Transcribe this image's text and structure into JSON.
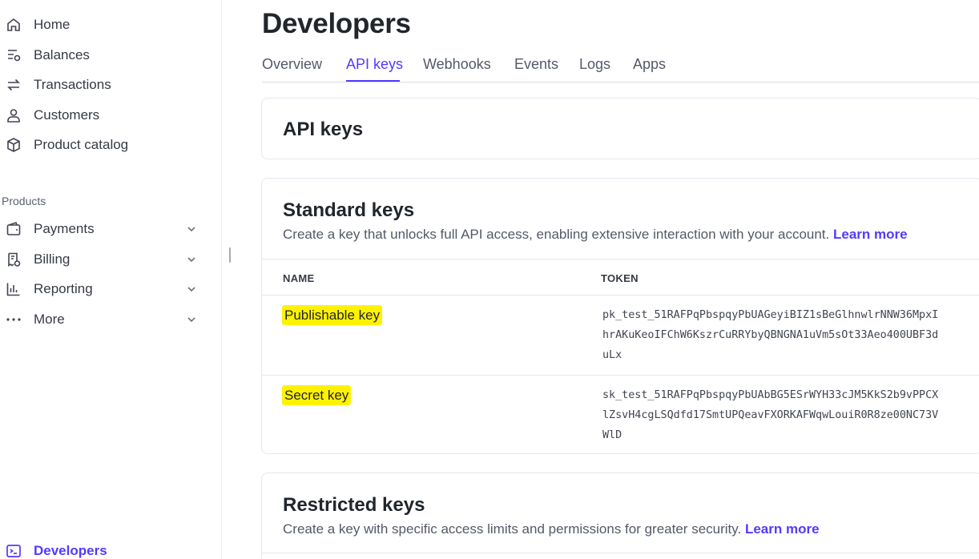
{
  "sidebar": {
    "items": [
      {
        "label": "Home",
        "icon": "home-icon"
      },
      {
        "label": "Balances",
        "icon": "balances-icon"
      },
      {
        "label": "Transactions",
        "icon": "transactions-icon"
      },
      {
        "label": "Customers",
        "icon": "customers-icon"
      },
      {
        "label": "Product catalog",
        "icon": "product-catalog-icon"
      }
    ],
    "products_label": "Products",
    "product_items": [
      {
        "label": "Payments",
        "icon": "payments-icon"
      },
      {
        "label": "Billing",
        "icon": "billing-icon"
      },
      {
        "label": "Reporting",
        "icon": "reporting-icon"
      },
      {
        "label": "More",
        "icon": "more-icon"
      }
    ],
    "developers_label": "Developers"
  },
  "page": {
    "title": "Developers",
    "tabs": [
      "Overview",
      "API keys",
      "Webhooks",
      "Events",
      "Logs",
      "Apps"
    ],
    "active_tab": "API keys"
  },
  "api_keys_card": {
    "title": "API keys"
  },
  "standard_keys": {
    "title": "Standard keys",
    "description": "Create a key that unlocks full API access, enabling extensive interaction with your account.",
    "learn_more": "Learn more",
    "col_name": "NAME",
    "col_token": "TOKEN",
    "rows": [
      {
        "name": "Publishable key",
        "token": "pk_test_51RAFPqPbspqyPbUAGeyiBIZ1sBeGlhnwlrNNW36MpxIhrAKuKeoIFChW6KszrCuRRYbyQBNGNA1uVm5sOt33Aeo400UBF3duLx"
      },
      {
        "name": "Secret key",
        "token": "sk_test_51RAFPqPbspqyPbUAbBG5ESrWYH33cJM5KkS2b9vPPCXlZsvH4cgLSQdfd17SmtUPQeavFXORKAFWqwLouiR0R8ze00NC73VWlD"
      }
    ]
  },
  "restricted_keys": {
    "title": "Restricted keys",
    "description": "Create a key with specific access limits and permissions for greater security.",
    "learn_more": "Learn more"
  },
  "colors": {
    "accent": "#533afd",
    "highlight": "#fff200",
    "text": "#353a44"
  }
}
